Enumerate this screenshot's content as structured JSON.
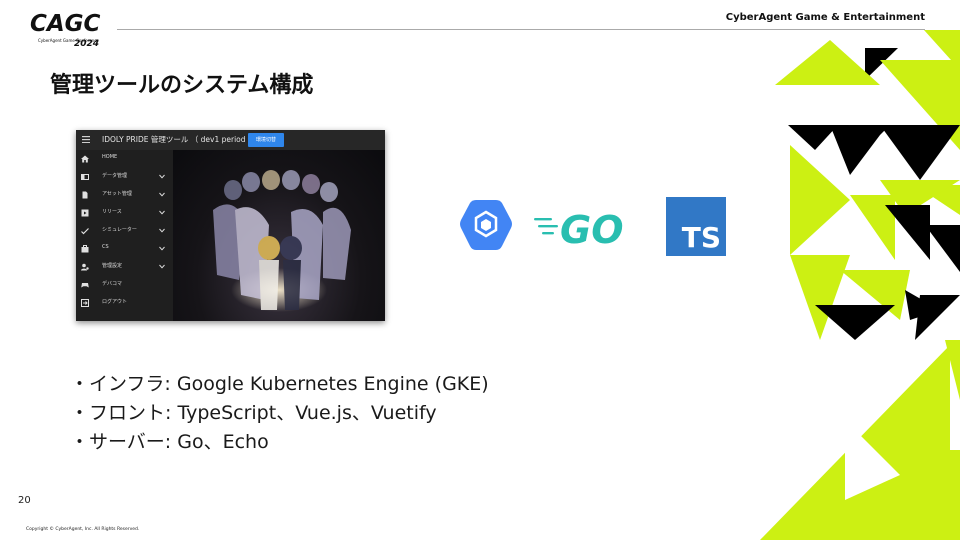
{
  "header": {
    "logo_text": "CAGC",
    "logo_subtext": "CyberAgent Game Conference",
    "logo_year": "2024",
    "company": "CyberAgent Game & Entertainment"
  },
  "slide": {
    "title": "管理ツールのシステム構成",
    "page_number": "20",
    "copyright": "Copyright © CyberAgent, Inc. All Rights Reserved."
  },
  "admin_tool": {
    "title": "IDOLY PRIDE 管理ツール （ dev1 period ）",
    "env_button": "環境切替",
    "nav": [
      {
        "label": "HOME",
        "icon": "home-icon",
        "chevron": false
      },
      {
        "label": "データ管理",
        "icon": "data-icon",
        "chevron": true
      },
      {
        "label": "アセット管理",
        "icon": "file-icon",
        "chevron": true
      },
      {
        "label": "リリース",
        "icon": "release-icon",
        "chevron": true
      },
      {
        "label": "シミュレーター",
        "icon": "check-icon",
        "chevron": true
      },
      {
        "label": "CS",
        "icon": "briefcase-icon",
        "chevron": true
      },
      {
        "label": "管理設定",
        "icon": "user-gear-icon",
        "chevron": true
      },
      {
        "label": "デバコマ",
        "icon": "gamepad-icon",
        "chevron": false
      },
      {
        "label": "ログアウト",
        "icon": "logout-icon",
        "chevron": false
      }
    ]
  },
  "tech_logos": {
    "go_text": "GO",
    "ts_text": "TS"
  },
  "bullets": [
    "・インフラ: Google Kubernetes Engine (GKE)",
    "・フロント: TypeScript、Vue.js、Vuetify",
    "・サーバー: Go、Echo"
  ],
  "colors": {
    "accent_lime": "#ccf013",
    "gke_blue": "#4285f4",
    "go_teal": "#29beb0",
    "ts_blue": "#3178c6",
    "env_button": "#2f86eb"
  }
}
